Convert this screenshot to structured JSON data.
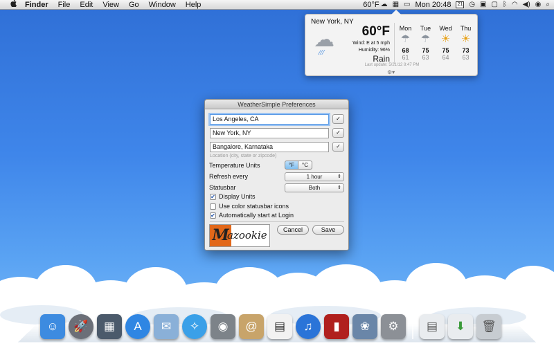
{
  "menubar": {
    "apple": "",
    "app_name": "Finder",
    "menus": [
      "File",
      "Edit",
      "View",
      "Go",
      "Window",
      "Help"
    ],
    "status_temp": "60°F",
    "clock": "Mon 20:48",
    "calendar_day": "21"
  },
  "weather": {
    "city": "New York, NY",
    "temperature": "60°F",
    "wind": "Wind: E at 5 mph",
    "humidity": "Humidity: 96%",
    "condition": "Rain",
    "last_update": "Last update: 5/21/12 8:47 PM",
    "forecast": [
      {
        "day": "Mon",
        "icon": "rain-cloud-icon",
        "high": "68",
        "low": "61"
      },
      {
        "day": "Tue",
        "icon": "rain-cloud-icon",
        "high": "75",
        "low": "63"
      },
      {
        "day": "Wed",
        "icon": "sun-cloud-icon",
        "high": "75",
        "low": "64"
      },
      {
        "day": "Thu",
        "icon": "sun-cloud-icon",
        "high": "73",
        "low": "63"
      }
    ]
  },
  "prefs": {
    "title": "WeatherSimple Preferences",
    "locations": [
      "Los Angeles, CA",
      "New York, NY",
      "Bangalore, Karnataka"
    ],
    "check_label": "✓",
    "hint": "Location (city, state or zipcode)",
    "temp_units_label": "Temperature Units",
    "unit_f": "°F",
    "unit_c": "°C",
    "refresh_label": "Refresh every",
    "refresh_value": "1 hour",
    "statusbar_label": "Statusbar",
    "statusbar_value": "Both",
    "display_units": "Display Units",
    "color_icons": "Use color statusbar icons",
    "auto_start": "Automatically start at Login",
    "cancel": "Cancel",
    "save": "Save",
    "logo_text": "azookie",
    "logo_mark": "M"
  },
  "dock": {
    "apps": [
      {
        "name": "finder-icon",
        "color": "#3d8be0"
      },
      {
        "name": "launchpad-icon",
        "color": "#6b6f78"
      },
      {
        "name": "mission-control-icon",
        "color": "#4b5a6b"
      },
      {
        "name": "app-store-icon",
        "color": "#2f86e3"
      },
      {
        "name": "mail-icon",
        "color": "#8ab0d8"
      },
      {
        "name": "safari-icon",
        "color": "#3aa0e8"
      },
      {
        "name": "facetime-icon",
        "color": "#7d8389"
      },
      {
        "name": "contacts-icon",
        "color": "#c8a46a"
      },
      {
        "name": "calendar-icon",
        "color": "#f2f2f2"
      },
      {
        "name": "itunes-icon",
        "color": "#2a74d8"
      },
      {
        "name": "photo-booth-icon",
        "color": "#b0201e"
      },
      {
        "name": "iphoto-icon",
        "color": "#6a86a8"
      },
      {
        "name": "system-preferences-icon",
        "color": "#8c9096"
      },
      {
        "name": "documents-stack-icon",
        "color": "#e9ecef"
      },
      {
        "name": "downloads-stack-icon",
        "color": "#e9ecef"
      },
      {
        "name": "trash-icon",
        "color": "#c7ccd1"
      }
    ]
  }
}
